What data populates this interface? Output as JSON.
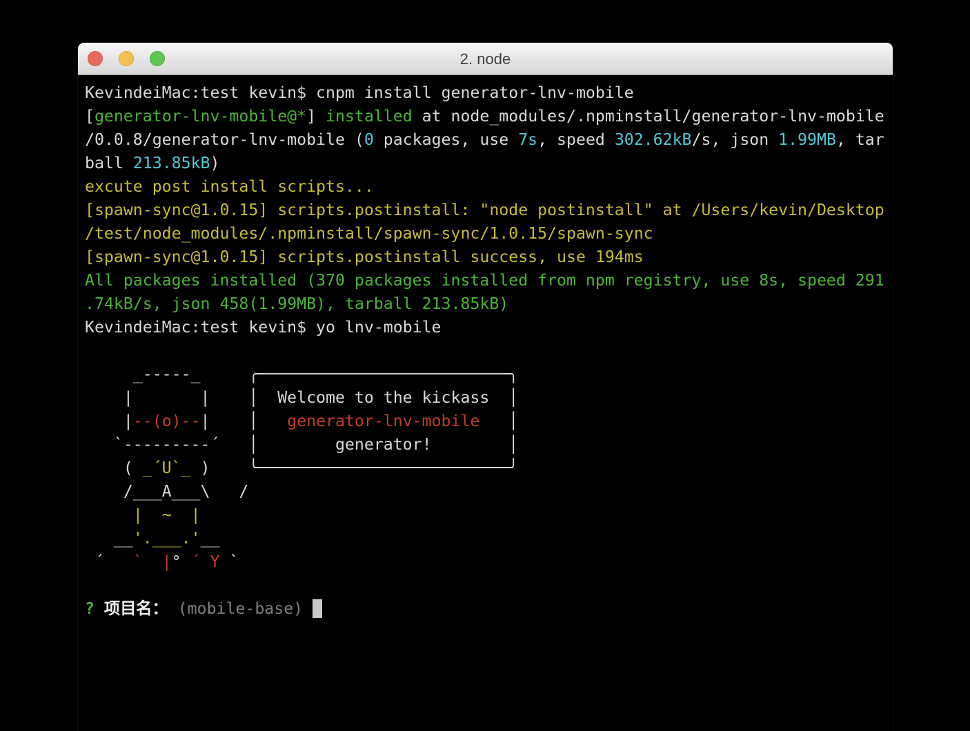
{
  "window": {
    "title": "2. node",
    "buttons": [
      {
        "name": "close",
        "color_key": "light_red"
      },
      {
        "name": "minimize",
        "color_key": "light_yellow"
      },
      {
        "name": "fullscreen",
        "color_key": "light_green"
      }
    ]
  },
  "colors": {
    "bg": "#000000",
    "fg": "#d9d9d9",
    "bright": "#f2f2f2",
    "green": "#4db335",
    "yellow": "#c4bb39",
    "cyan": "#4ec9d6",
    "red": "#c23b2a",
    "dim": "#7f7f7f",
    "cursor": "#c9c9c9",
    "light_red": "#e96b5f",
    "light_yellow": "#f4bf4f",
    "light_green": "#5fc553",
    "title_text": "#3e3e3e"
  },
  "terminal": {
    "prompt_default_value": "mobile-base",
    "prompt_question": "项目名：",
    "lines": [
      [
        [
          "KevindeiMac:test kevin$ cnpm install generator-lnv-mobile",
          "w"
        ]
      ],
      [
        [
          "[",
          "w"
        ],
        [
          "generator-lnv-mobile@*",
          "g"
        ],
        [
          "]",
          "w"
        ],
        [
          " ",
          "w"
        ],
        [
          "installed",
          "g"
        ],
        [
          " at node_modules/.npminstall/generator-lnv-mobile",
          "w"
        ]
      ],
      [
        [
          "/0.0.8/generator-lnv-mobile (",
          "w"
        ],
        [
          "0",
          "c"
        ],
        [
          " packages, use ",
          "w"
        ],
        [
          "7s",
          "c"
        ],
        [
          ", speed ",
          "w"
        ],
        [
          "302.62kB",
          "c"
        ],
        [
          "/s, json ",
          "w"
        ],
        [
          "1.99MB",
          "c"
        ],
        [
          ", tar",
          "w"
        ]
      ],
      [
        [
          "ball ",
          "w"
        ],
        [
          "213.85kB",
          "c"
        ],
        [
          ")",
          "w"
        ]
      ],
      [
        [
          "excute post install scripts...",
          "y"
        ]
      ],
      [
        [
          "[spawn-sync@1.0.15] scripts.postinstall: \"node postinstall\" at /Users/kevin/Desktop",
          "y"
        ]
      ],
      [
        [
          "/test/node_modules/.npminstall/spawn-sync/1.0.15/spawn-sync",
          "y"
        ]
      ],
      [
        [
          "[spawn-sync@1.0.15] scripts.postinstall success, use 194ms",
          "y"
        ]
      ],
      [
        [
          "All packages installed (370 packages installed from npm registry, use 8s, speed 291",
          "g"
        ]
      ],
      [
        [
          ".74kB/s, json 458(1.99MB), tarball 213.85kB)",
          "g"
        ]
      ],
      [
        [
          "KevindeiMac:test kevin$ yo lnv-mobile",
          "w"
        ]
      ],
      [],
      [
        [
          "     _-----_     ╭──────────────────────────╮",
          "w"
        ]
      ],
      [
        [
          "    |       |    │  Welcome to the kickass  │",
          "w"
        ]
      ],
      [
        [
          "    |",
          "w"
        ],
        [
          "--(o)--",
          "r"
        ],
        [
          "|    │   ",
          "w"
        ],
        [
          "generator-lnv-mobile",
          "r"
        ],
        [
          "   │",
          "w"
        ]
      ],
      [
        [
          "   `---------´   │        generator!        │",
          "w"
        ]
      ],
      [
        [
          "    ( ",
          "w"
        ],
        [
          "_´U`_",
          "y"
        ],
        [
          " )    ╰──────────────────────────╯",
          "w"
        ]
      ],
      [
        [
          "    /___A___\\   /",
          "w"
        ]
      ],
      [
        [
          "     ",
          "w"
        ],
        [
          "|  ~  |",
          "y"
        ]
      ],
      [
        [
          "   __",
          "w"
        ],
        [
          "'.___.'",
          "y"
        ],
        [
          "__",
          "w"
        ]
      ],
      [
        [
          " ´   ",
          "w"
        ],
        [
          "`  |",
          "r"
        ],
        [
          "° ",
          "w"
        ],
        [
          "´ Y",
          "r"
        ],
        [
          " `",
          "w"
        ]
      ],
      [],
      [
        [
          "? ",
          "gb"
        ],
        [
          "项目名： ",
          "wb"
        ],
        [
          "(mobile-base) ",
          "d"
        ],
        [
          " ",
          "cursor"
        ]
      ]
    ]
  }
}
